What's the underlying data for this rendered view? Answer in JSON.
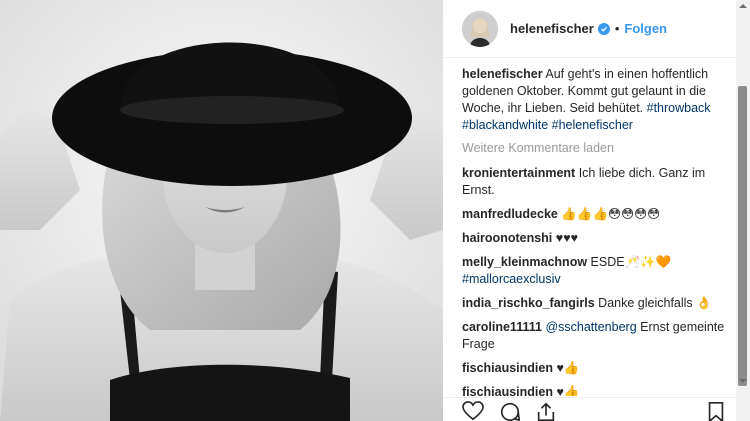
{
  "post": {
    "photo_alt": "helenefischer post photo"
  },
  "header": {
    "username": "helenefischer",
    "separator": "•",
    "follow_label": "Folgen"
  },
  "caption": {
    "username": "helenefischer",
    "text": "Auf geht's in einen hoffentlich goldenen Oktober. Kommt gut gelaunt in die Woche, ihr Lieben. Seid behütet.",
    "tags": "#throwback #blackandwhite #helenefischer"
  },
  "load_more_label": "Weitere Kommentare laden",
  "comments": [
    {
      "username": "kronientertainment",
      "text": "Ich liebe dich. Ganz im Ernst."
    },
    {
      "username": "manfredludecke",
      "text": "👍👍👍😳😳😳😳"
    },
    {
      "username": "hairoonotenshi",
      "text": "♥♥♥"
    },
    {
      "username": "melly_kleinmachnow",
      "text": "ESDE🥂✨🧡",
      "tag": "#mallorcaexclusiv"
    },
    {
      "username": "india_rischko_fangirls",
      "text": "Danke gleichfalls 👌"
    },
    {
      "username": "caroline11111",
      "mention": "@sschattenberg",
      "text": "Ernst gemeinte Frage"
    },
    {
      "username": "fischiausindien",
      "text": "♥👍"
    },
    {
      "username": "fischiausindien",
      "text": "♥👍"
    }
  ],
  "actions": {
    "icons": [
      "heart-icon",
      "comment-icon",
      "share-icon",
      "bookmark-icon"
    ]
  },
  "colors": {
    "accent": "#3897f0",
    "hashtag": "#003569",
    "muted": "#999999",
    "text": "#262626"
  }
}
